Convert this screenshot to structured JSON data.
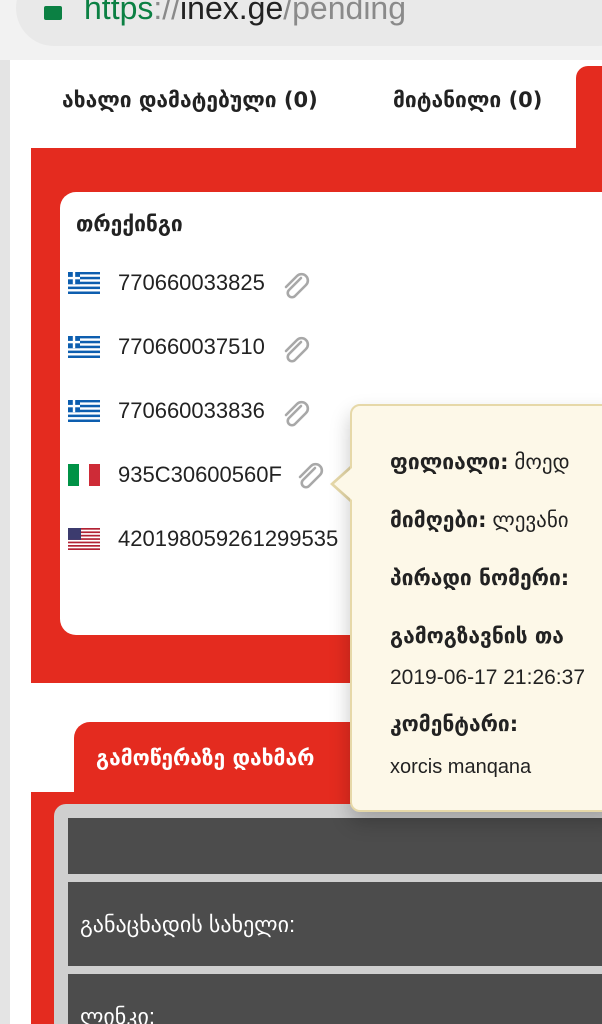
{
  "browser": {
    "url_protocol": "https",
    "url_sep": "://",
    "url_host": "inex.ge",
    "url_path": "/pending"
  },
  "tabs": [
    {
      "label": "ახალი დამატებული (0)"
    },
    {
      "label": "მიტანილი (0)"
    }
  ],
  "tracking_card": {
    "title": "თრექინგი",
    "items": [
      {
        "number": "770660033825",
        "flag": "greece"
      },
      {
        "number": "770660037510",
        "flag": "greece"
      },
      {
        "number": "770660033836",
        "flag": "greece"
      },
      {
        "number": "935C30600560F",
        "flag": "italy"
      },
      {
        "number": "42019805926129953​5",
        "flag": "usa"
      }
    ]
  },
  "tooltip": {
    "branch_label": "ფილიალი:",
    "branch_value": " მოედ",
    "receiver_label": "მიმღები:",
    "receiver_value": " ლევანი",
    "personal_label": "პირადი ნომერი:",
    "sent_label": "გამოგზავნის თა",
    "sent_value": "2019-06-17 21:26:37",
    "comment_label": "კომენტარი:",
    "comment_value": "xorcis manqana"
  },
  "second_section": {
    "tab_label": "გამოწერაზე დახმარ",
    "app_name_label": "განაცხადის სახელი:",
    "link_label": "ლინკი:"
  },
  "colors": {
    "accent_red": "#e42b1f",
    "url_green": "#0b8043",
    "tooltip_bg": "#fdf8e8"
  },
  "icons": {
    "lock": "lock-icon",
    "attachment": "paperclip-icon"
  }
}
